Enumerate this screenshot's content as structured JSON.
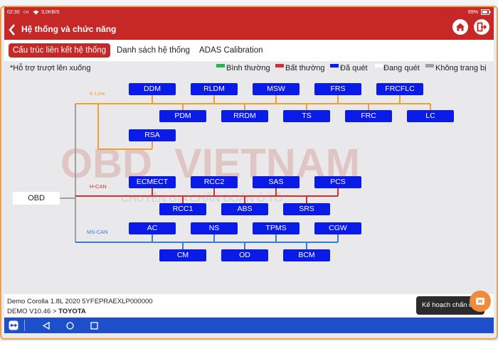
{
  "status": {
    "time": "02:30",
    "time_suffix": "CH",
    "net_speed": "3,0KB/S",
    "battery": "69%"
  },
  "header": {
    "title": "Hệ thống và chức năng",
    "back_icon": "chevron-left-icon",
    "home_icon": "home-icon",
    "exit_icon": "exit-icon"
  },
  "tabs": [
    {
      "label": "Cấu trúc liên kết hệ thống",
      "active": true
    },
    {
      "label": "Danh sách hệ thống",
      "active": false
    },
    {
      "label": "ADAS Calibration",
      "active": false
    }
  ],
  "main": {
    "hint": "*Hỗ trợ trượt lên xuống",
    "legend": [
      {
        "label": "Bình thường",
        "color": "#2db34a"
      },
      {
        "label": "Bất thường",
        "color": "#d32f2f"
      },
      {
        "label": "Đã quét",
        "color": "#0a1be8"
      },
      {
        "label": "Đang quét",
        "color": "#ffffff"
      },
      {
        "label": "Không trang bị",
        "color": "#a0a0a0"
      }
    ]
  },
  "topology": {
    "root": "OBD",
    "buses": [
      {
        "name": "K-Line",
        "color": "#f0a030",
        "upper": [
          "DDM",
          "RLDM",
          "MSW",
          "FRS",
          "FRCFLC"
        ],
        "lower": [
          "PDM",
          "RRDM",
          "TS",
          "FRC",
          "LC"
        ],
        "extra": [
          "RSA"
        ]
      },
      {
        "name": "H-CAN",
        "color": "#d32f2f",
        "upper": [
          "ECMECT",
          "RCC2",
          "SAS",
          "PCS"
        ],
        "lower": [
          "RCC1",
          "ABS",
          "SRS"
        ]
      },
      {
        "name": "MS-CAN",
        "color": "#3a7bd5",
        "upper": [
          "AC",
          "NS",
          "TPMS",
          "CGW"
        ],
        "lower": [
          "CM",
          "OD",
          "BCM"
        ]
      }
    ],
    "watermark": {
      "brand": "OBDVIETNAM",
      "tagline": "CHUYÊN GIA CHẨN ĐOÁN Ô TÔ"
    }
  },
  "footer": {
    "vehicle_line": "Demo  Corolla 1.8L 2020  5YFEPRAEXLP000000",
    "version": "DEMO V10.46 > ",
    "make": "TOYOTA",
    "plan_button": "Kế hoạch chẩn đ"
  },
  "navbar": {
    "app_icon": "app-switch-icon",
    "back_icon": "nav-back-icon",
    "home_icon": "nav-home-icon",
    "recent_icon": "nav-recent-icon"
  }
}
